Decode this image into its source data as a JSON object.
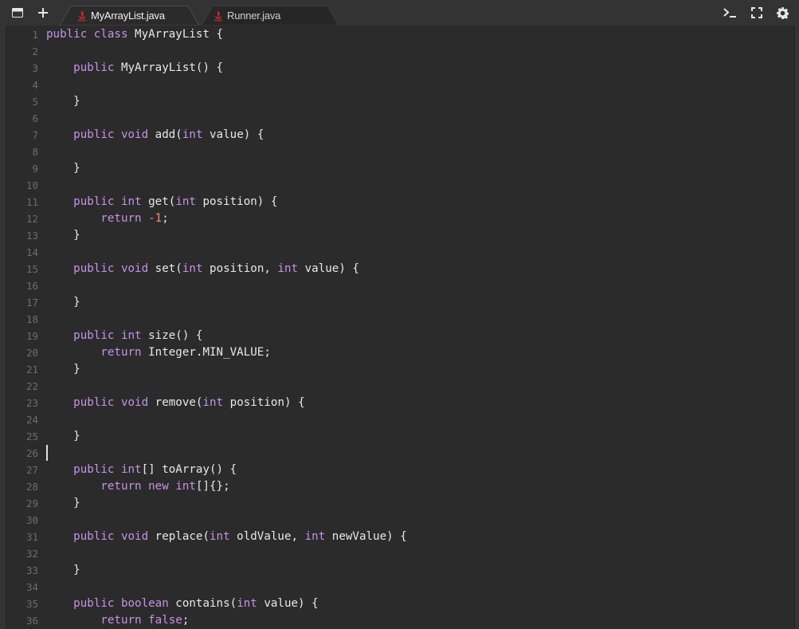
{
  "toolbar": {
    "panel_icon": "panel-icon",
    "new_tab_icon": "plus-icon",
    "terminal_icon": "terminal-icon",
    "fullscreen_icon": "fullscreen-icon",
    "settings_icon": "gear-icon"
  },
  "tabs": [
    {
      "label": "MyArrayList.java",
      "active": true,
      "icon": "java-file-icon"
    },
    {
      "label": "Runner.java",
      "active": false,
      "icon": "java-file-icon"
    }
  ],
  "colors": {
    "background": "#333333",
    "editor_background": "#2b2b2b",
    "keyword": "#c792ea",
    "number": "#f78c6c",
    "text": "#e8e8e8",
    "line_number": "#6d6d6d",
    "java_icon": "#d8332e"
  },
  "editor": {
    "cursor_line": 26,
    "lines": [
      {
        "n": "1",
        "tokens": [
          {
            "t": "public",
            "k": "kw"
          },
          {
            "t": " "
          },
          {
            "t": "class",
            "k": "kw"
          },
          {
            "t": " MyArrayList {"
          }
        ]
      },
      {
        "n": "2",
        "tokens": []
      },
      {
        "n": "3",
        "tokens": [
          {
            "t": "    "
          },
          {
            "t": "public",
            "k": "kw"
          },
          {
            "t": " MyArrayList() {"
          }
        ]
      },
      {
        "n": "4",
        "tokens": []
      },
      {
        "n": "5",
        "tokens": [
          {
            "t": "    }"
          }
        ]
      },
      {
        "n": "6",
        "tokens": []
      },
      {
        "n": "7",
        "tokens": [
          {
            "t": "    "
          },
          {
            "t": "public",
            "k": "kw"
          },
          {
            "t": " "
          },
          {
            "t": "void",
            "k": "kw"
          },
          {
            "t": " add("
          },
          {
            "t": "int",
            "k": "kw"
          },
          {
            "t": " value) {"
          }
        ]
      },
      {
        "n": "8",
        "tokens": []
      },
      {
        "n": "9",
        "tokens": [
          {
            "t": "    }"
          }
        ]
      },
      {
        "n": "10",
        "tokens": []
      },
      {
        "n": "11",
        "tokens": [
          {
            "t": "    "
          },
          {
            "t": "public",
            "k": "kw"
          },
          {
            "t": " "
          },
          {
            "t": "int",
            "k": "kw"
          },
          {
            "t": " get("
          },
          {
            "t": "int",
            "k": "kw"
          },
          {
            "t": " position) {"
          }
        ]
      },
      {
        "n": "12",
        "tokens": [
          {
            "t": "        "
          },
          {
            "t": "return",
            "k": "kw"
          },
          {
            "t": " "
          },
          {
            "t": "-1",
            "k": "num"
          },
          {
            "t": ";"
          }
        ]
      },
      {
        "n": "13",
        "tokens": [
          {
            "t": "    }"
          }
        ]
      },
      {
        "n": "14",
        "tokens": []
      },
      {
        "n": "15",
        "tokens": [
          {
            "t": "    "
          },
          {
            "t": "public",
            "k": "kw"
          },
          {
            "t": " "
          },
          {
            "t": "void",
            "k": "kw"
          },
          {
            "t": " set("
          },
          {
            "t": "int",
            "k": "kw"
          },
          {
            "t": " position, "
          },
          {
            "t": "int",
            "k": "kw"
          },
          {
            "t": " value) {"
          }
        ]
      },
      {
        "n": "16",
        "tokens": []
      },
      {
        "n": "17",
        "tokens": [
          {
            "t": "    }"
          }
        ]
      },
      {
        "n": "18",
        "tokens": []
      },
      {
        "n": "19",
        "tokens": [
          {
            "t": "    "
          },
          {
            "t": "public",
            "k": "kw"
          },
          {
            "t": " "
          },
          {
            "t": "int",
            "k": "kw"
          },
          {
            "t": " size() {"
          }
        ]
      },
      {
        "n": "20",
        "tokens": [
          {
            "t": "        "
          },
          {
            "t": "return",
            "k": "kw"
          },
          {
            "t": " Integer.MIN_VALUE;"
          }
        ]
      },
      {
        "n": "21",
        "tokens": [
          {
            "t": "    }"
          }
        ]
      },
      {
        "n": "22",
        "tokens": []
      },
      {
        "n": "23",
        "tokens": [
          {
            "t": "    "
          },
          {
            "t": "public",
            "k": "kw"
          },
          {
            "t": " "
          },
          {
            "t": "void",
            "k": "kw"
          },
          {
            "t": " remove("
          },
          {
            "t": "int",
            "k": "kw"
          },
          {
            "t": " position) {"
          }
        ]
      },
      {
        "n": "24",
        "tokens": []
      },
      {
        "n": "25",
        "tokens": [
          {
            "t": "    }"
          }
        ]
      },
      {
        "n": "26",
        "tokens": []
      },
      {
        "n": "27",
        "tokens": [
          {
            "t": "    "
          },
          {
            "t": "public",
            "k": "kw"
          },
          {
            "t": " "
          },
          {
            "t": "int",
            "k": "kw"
          },
          {
            "t": "[] toArray() {"
          }
        ]
      },
      {
        "n": "28",
        "tokens": [
          {
            "t": "        "
          },
          {
            "t": "return",
            "k": "kw"
          },
          {
            "t": " "
          },
          {
            "t": "new",
            "k": "kw"
          },
          {
            "t": " "
          },
          {
            "t": "int",
            "k": "kw"
          },
          {
            "t": "[]{};"
          }
        ]
      },
      {
        "n": "29",
        "tokens": [
          {
            "t": "    }"
          }
        ]
      },
      {
        "n": "30",
        "tokens": []
      },
      {
        "n": "31",
        "tokens": [
          {
            "t": "    "
          },
          {
            "t": "public",
            "k": "kw"
          },
          {
            "t": " "
          },
          {
            "t": "void",
            "k": "kw"
          },
          {
            "t": " replace("
          },
          {
            "t": "int",
            "k": "kw"
          },
          {
            "t": " oldValue, "
          },
          {
            "t": "int",
            "k": "kw"
          },
          {
            "t": " newValue) {"
          }
        ]
      },
      {
        "n": "32",
        "tokens": []
      },
      {
        "n": "33",
        "tokens": [
          {
            "t": "    }"
          }
        ]
      },
      {
        "n": "34",
        "tokens": []
      },
      {
        "n": "35",
        "tokens": [
          {
            "t": "    "
          },
          {
            "t": "public",
            "k": "kw"
          },
          {
            "t": " "
          },
          {
            "t": "boolean",
            "k": "kw"
          },
          {
            "t": " contains("
          },
          {
            "t": "int",
            "k": "kw"
          },
          {
            "t": " value) {"
          }
        ]
      },
      {
        "n": "36",
        "tokens": [
          {
            "t": "        "
          },
          {
            "t": "return",
            "k": "kw"
          },
          {
            "t": " "
          },
          {
            "t": "false",
            "k": "kw"
          },
          {
            "t": ";"
          }
        ]
      }
    ]
  }
}
